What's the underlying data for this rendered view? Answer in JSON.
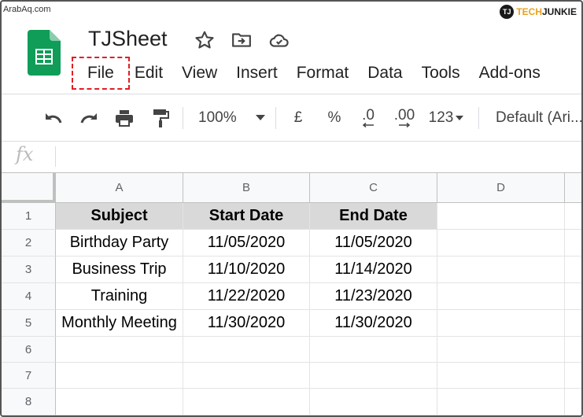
{
  "watermarks": {
    "left": "ArabAq.com",
    "right_badge": "TJ",
    "right_tech": "TECH",
    "right_junkie": "JUNKIE"
  },
  "app": {
    "logo_icon": "google-sheets-logo-icon",
    "title": "TJSheet",
    "title_icons": [
      "star-icon",
      "move-to-folder-icon",
      "cloud-saved-icon"
    ],
    "accent_color": "#0f9d58",
    "highlight_color": "#e01f26"
  },
  "menu": [
    {
      "key": "file",
      "label": "File"
    },
    {
      "key": "edit",
      "label": "Edit"
    },
    {
      "key": "view",
      "label": "View"
    },
    {
      "key": "insert",
      "label": "Insert"
    },
    {
      "key": "format",
      "label": "Format"
    },
    {
      "key": "data",
      "label": "Data"
    },
    {
      "key": "tools",
      "label": "Tools"
    },
    {
      "key": "addons",
      "label": "Add-ons"
    }
  ],
  "toolbar": {
    "zoom": "100%",
    "currency": "£",
    "percent": "%",
    "decrease_decimal": ".0",
    "increase_decimal": ".00",
    "more_formats": "123",
    "font": "Default (Ari..."
  },
  "formula_bar": {
    "fx_label": "fx",
    "value": ""
  },
  "sheet": {
    "columns": [
      "A",
      "B",
      "C",
      "D"
    ],
    "rows": [
      {
        "num": "1",
        "cells": [
          "Subject",
          "Start Date",
          "End Date",
          ""
        ]
      },
      {
        "num": "2",
        "cells": [
          "Birthday Party",
          "11/05/2020",
          "11/05/2020",
          ""
        ]
      },
      {
        "num": "3",
        "cells": [
          "Business Trip",
          "11/10/2020",
          "11/14/2020",
          ""
        ]
      },
      {
        "num": "4",
        "cells": [
          "Training",
          "11/22/2020",
          "11/23/2020",
          ""
        ]
      },
      {
        "num": "5",
        "cells": [
          "Monthly Meeting",
          "11/30/2020",
          "11/30/2020",
          ""
        ]
      },
      {
        "num": "6",
        "cells": [
          "",
          "",
          "",
          ""
        ]
      },
      {
        "num": "7",
        "cells": [
          "",
          "",
          "",
          ""
        ]
      },
      {
        "num": "8",
        "cells": [
          "",
          "",
          "",
          ""
        ]
      }
    ]
  }
}
